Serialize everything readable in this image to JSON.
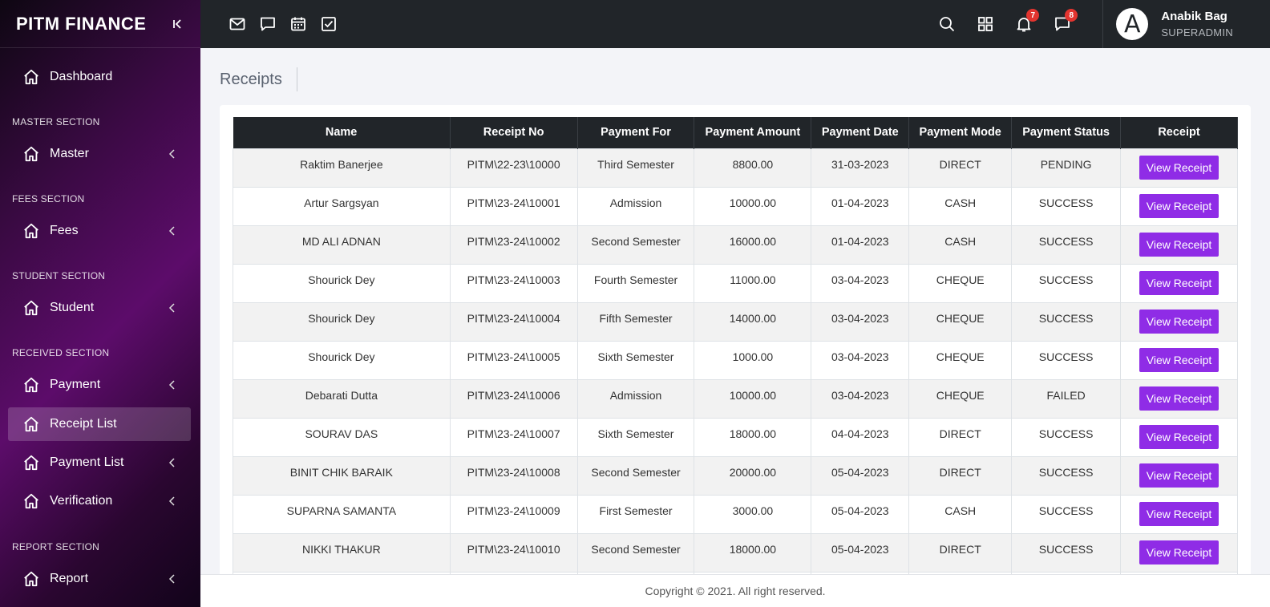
{
  "sidebar": {
    "brand": "PITM FINANCE",
    "sections": {
      "master": "MASTER SECTION",
      "fees": "FEES SECTION",
      "student": "STUDENT SECTION",
      "received": "RECEIVED SECTION",
      "report": "REPORT SECTION"
    },
    "items": {
      "dashboard": "Dashboard",
      "master": "Master",
      "fees": "Fees",
      "student": "Student",
      "payment": "Payment",
      "receipt_list": "Receipt List",
      "payment_list": "Payment List",
      "verification": "Verification",
      "report": "Report"
    }
  },
  "topbar": {
    "notifications_count": "7",
    "messages_count": "8",
    "user": {
      "initial": "A",
      "name": "Anabik Bag",
      "role": "SUPERADMIN"
    }
  },
  "page": {
    "title": "Receipts"
  },
  "table": {
    "headers": [
      "Name",
      "Receipt No",
      "Payment For",
      "Payment Amount",
      "Payment Date",
      "Payment Mode",
      "Payment Status",
      "Receipt"
    ],
    "button_label": "View Receipt",
    "rows": [
      [
        "Raktim Banerjee",
        "PITM\\22-23\\10000",
        "Third Semester",
        "8800.00",
        "31-03-2023",
        "DIRECT",
        "PENDING"
      ],
      [
        "Artur Sargsyan",
        "PITM\\23-24\\10001",
        "Admission",
        "10000.00",
        "01-04-2023",
        "CASH",
        "SUCCESS"
      ],
      [
        "MD ALI ADNAN",
        "PITM\\23-24\\10002",
        "Second Semester",
        "16000.00",
        "01-04-2023",
        "CASH",
        "SUCCESS"
      ],
      [
        "Shourick Dey",
        "PITM\\23-24\\10003",
        "Fourth Semester",
        "11000.00",
        "03-04-2023",
        "CHEQUE",
        "SUCCESS"
      ],
      [
        "Shourick Dey",
        "PITM\\23-24\\10004",
        "Fifth Semester",
        "14000.00",
        "03-04-2023",
        "CHEQUE",
        "SUCCESS"
      ],
      [
        "Shourick Dey",
        "PITM\\23-24\\10005",
        "Sixth Semester",
        "1000.00",
        "03-04-2023",
        "CHEQUE",
        "SUCCESS"
      ],
      [
        "Debarati Dutta",
        "PITM\\23-24\\10006",
        "Admission",
        "10000.00",
        "03-04-2023",
        "CHEQUE",
        "FAILED"
      ],
      [
        "SOURAV DAS",
        "PITM\\23-24\\10007",
        "Sixth Semester",
        "18000.00",
        "04-04-2023",
        "DIRECT",
        "SUCCESS"
      ],
      [
        "BINIT CHIK BARAIK",
        "PITM\\23-24\\10008",
        "Second Semester",
        "20000.00",
        "05-04-2023",
        "DIRECT",
        "SUCCESS"
      ],
      [
        "SUPARNA SAMANTA",
        "PITM\\23-24\\10009",
        "First Semester",
        "3000.00",
        "05-04-2023",
        "CASH",
        "SUCCESS"
      ],
      [
        "NIKKI THAKUR",
        "PITM\\23-24\\10010",
        "Second Semester",
        "18000.00",
        "05-04-2023",
        "DIRECT",
        "SUCCESS"
      ],
      [
        "",
        "",
        "",
        "",
        "",
        "",
        ""
      ]
    ]
  },
  "footer": {
    "text": "Copyright © 2021. All right reserved."
  }
}
